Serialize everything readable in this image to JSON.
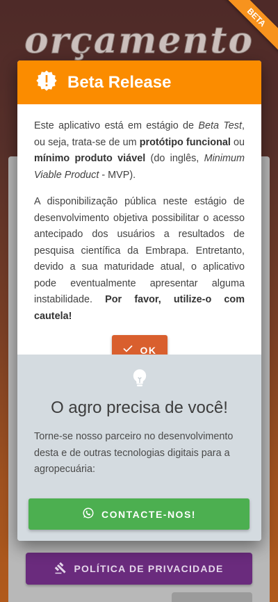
{
  "background": {
    "app_title": "orçamento",
    "beta_ribbon": "BETA",
    "privacy_button": "POLÍTICA DE PRIVACIDADE"
  },
  "dialog": {
    "title": "Beta Release",
    "header_icon": "alert-seal-icon",
    "body": {
      "p1_a": "Este aplicativo está em estágio de ",
      "p1_b": "Beta Test",
      "p1_c": ", ou seja, trata-se de um ",
      "p1_d": "protótipo funcional",
      "p1_e": " ou ",
      "p1_f": "mínimo produto viável",
      "p1_g": " (do inglês, ",
      "p1_h": "Minimum Viable Product",
      "p1_i": " - MVP).",
      "p2_a": "A disponibilização pública neste estágio de desenvolvimento objetiva possibilitar o acesso antecipado dos usuários a resultados de pesquisa científica da Embrapa. Entretanto, devido a sua maturidade atual, o aplicativo pode eventualmente apresentar alguma instabilidade. ",
      "p2_b": "Por favor, utilize-o com cautela!"
    },
    "ok_button": "OK"
  },
  "partner": {
    "icon": "lightbulb-icon",
    "title": "O agro precisa de você!",
    "text": "Torne-se nosso parceiro no desenvolvimento desta e de outras tecnologias digitais para a agropecuária:",
    "contact_button": "CONTACTE-NOS!"
  },
  "colors": {
    "header": "#fb8c00",
    "ok_button": "#d95f2e",
    "contact_button": "#4caf50",
    "privacy_button": "#6a2b7d"
  }
}
